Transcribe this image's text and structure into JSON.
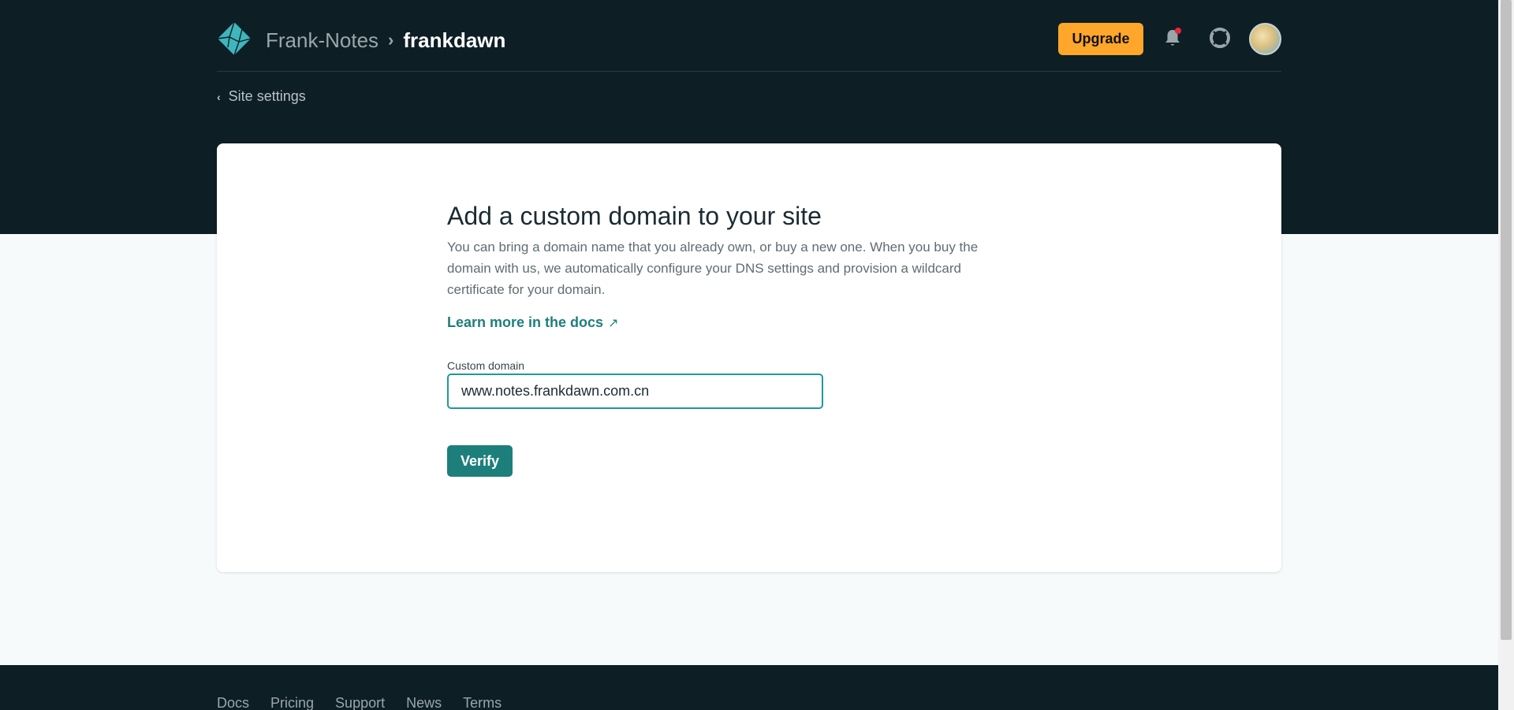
{
  "header": {
    "team_name": "Frank-Notes",
    "separator": "›",
    "site_name": "frankdawn",
    "upgrade_label": "Upgrade"
  },
  "icons": {
    "logo": "netlify-logo",
    "notifications": "bell-icon",
    "help": "lifebuoy-icon",
    "avatar": "user-avatar"
  },
  "back_link": {
    "label": "Site settings"
  },
  "card": {
    "title": "Add a custom domain to your site",
    "description": "You can bring a domain name that you already own, or buy a new one. When you buy the domain with us, we automatically configure your DNS settings and provision a wildcard certificate for your domain.",
    "docs_link": "Learn more in the docs",
    "docs_link_icon": "↗",
    "field_label": "Custom domain",
    "field_value": "www.notes.frankdawn.com.cn",
    "verify_label": "Verify"
  },
  "footer": {
    "links": [
      "Docs",
      "Pricing",
      "Support",
      "News",
      "Terms"
    ]
  },
  "colors": {
    "dark_bg": "#0e1e25",
    "accent_teal": "#1d7f7b",
    "upgrade_orange": "#ffa62b",
    "notification_dot": "#e5283b"
  }
}
